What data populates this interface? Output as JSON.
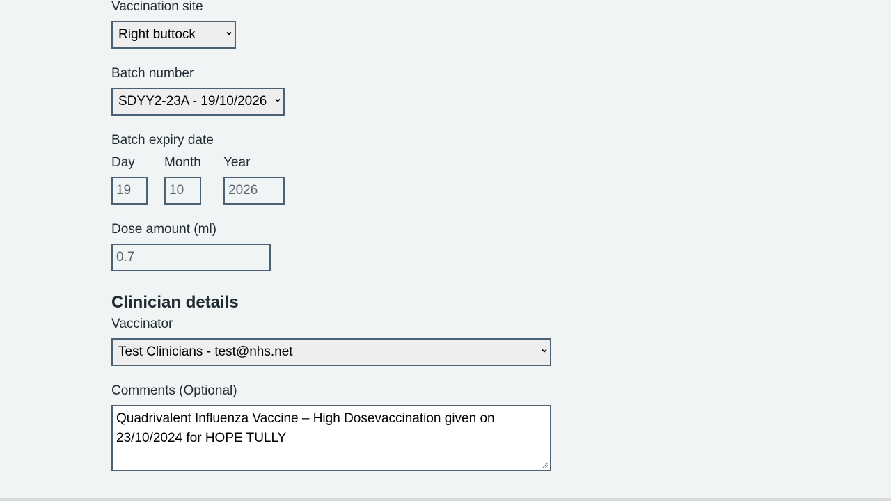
{
  "vaccination_site": {
    "label": "Vaccination site",
    "selected": "Right buttock"
  },
  "batch_number": {
    "label": "Batch number",
    "selected": "SDYY2-23A - 19/10/2026"
  },
  "batch_expiry": {
    "label": "Batch expiry date",
    "day_label": "Day",
    "day_value": "19",
    "month_label": "Month",
    "month_value": "10",
    "year_label": "Year",
    "year_value": "2026"
  },
  "dose_amount": {
    "label": "Dose amount (ml)",
    "value": "0.7"
  },
  "clinician": {
    "heading": "Clinician details",
    "vaccinator_label": "Vaccinator",
    "vaccinator_selected": "Test Clinicians - test@nhs.net"
  },
  "comments": {
    "label": "Comments (Optional)",
    "value": "Quadrivalent Influenza Vaccine – High Dosevaccination given on 23/10/2024 for HOPE TULLY"
  },
  "icons": {
    "select_arrow": "chevron-down-icon",
    "resize": "resize-grip-icon"
  },
  "colors": {
    "page_background": "#f0f4f5",
    "field_border": "#4c6272",
    "text": "#212b32"
  }
}
